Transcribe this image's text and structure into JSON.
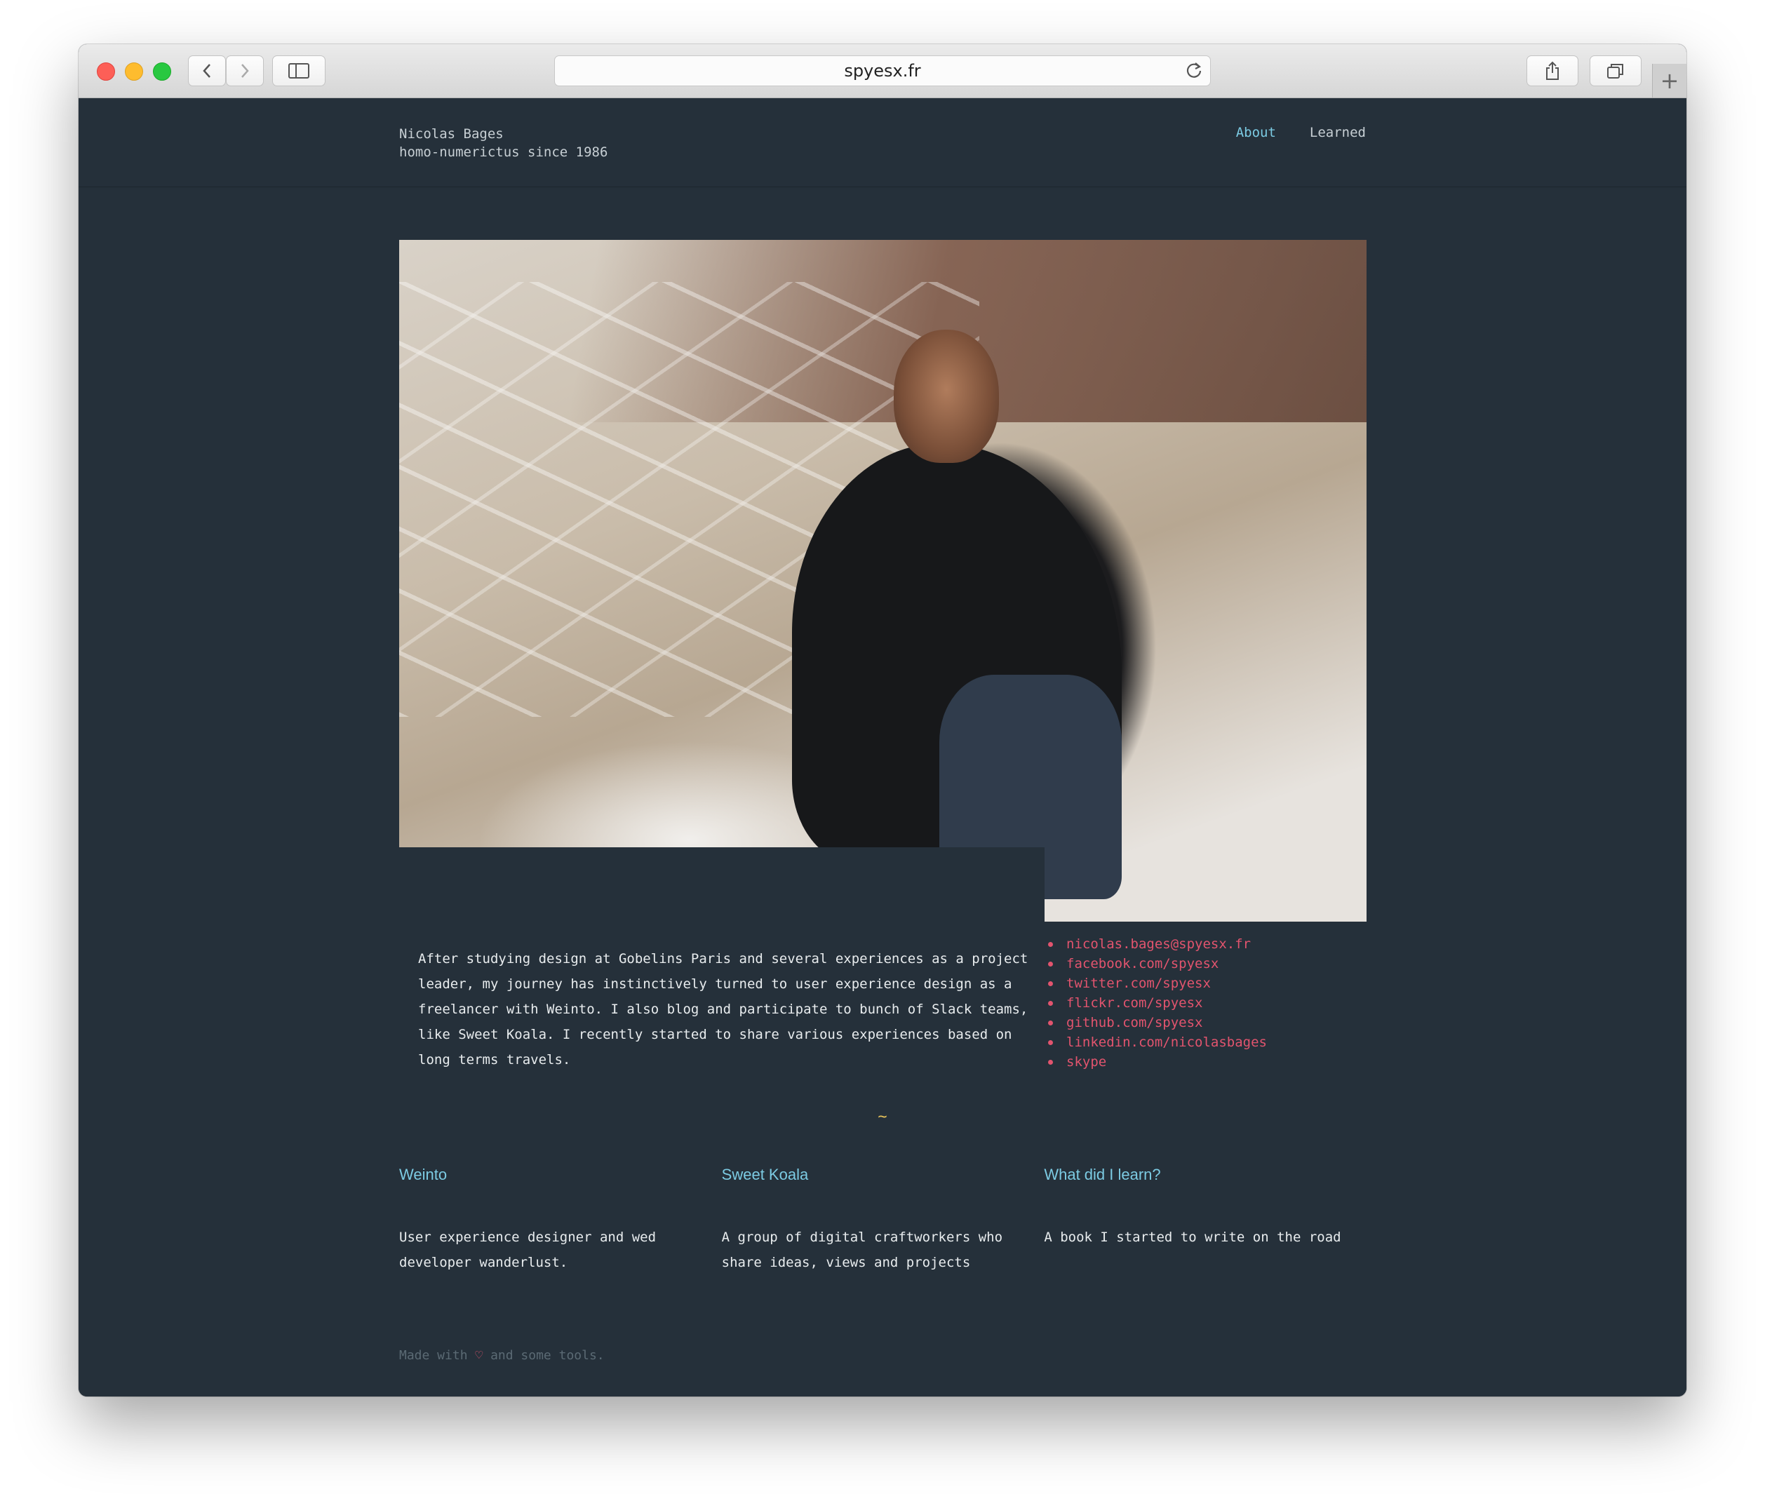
{
  "browser": {
    "address": "spyesx.fr",
    "colors": {
      "close": "#fd5f57",
      "minimize": "#febc2e",
      "zoom": "#28c840"
    }
  },
  "site": {
    "name": "Nicolas Bages",
    "tagline": "homo-numerictus since 1986",
    "nav": [
      {
        "label": "About",
        "active": true
      },
      {
        "label": "Learned",
        "active": false
      }
    ]
  },
  "bio": "After studying design at Gobelins Paris and several experiences as a project leader, my journey has instinctively turned to user experience design as a freelancer with Weinto. I also blog and participate to bunch of Slack teams, like Sweet Koala. I recently started to share various experiences based on long terms travels.",
  "links": [
    "nicolas.bages@spyesx.fr",
    "facebook.com/spyesx",
    "twitter.com/spyesx",
    "flickr.com/spyesx",
    "github.com/spyesx",
    "linkedin.com/nicolasbages",
    "skype"
  ],
  "separator": "~",
  "projects": [
    {
      "title": "Weinto",
      "description": "User experience designer and wed developer wanderlust."
    },
    {
      "title": "Sweet Koala",
      "description": "A group of digital craftworkers who share ideas, views and projects"
    },
    {
      "title": "What did I learn?",
      "description": "A book I started to write on the road"
    }
  ],
  "footer": {
    "before": "Made with",
    "heart": "♡",
    "after": "and some tools."
  },
  "colors": {
    "background": "#25303a",
    "accent_link": "#7ccbe3",
    "social_link": "#e2546e",
    "separator": "#e6c25a"
  }
}
